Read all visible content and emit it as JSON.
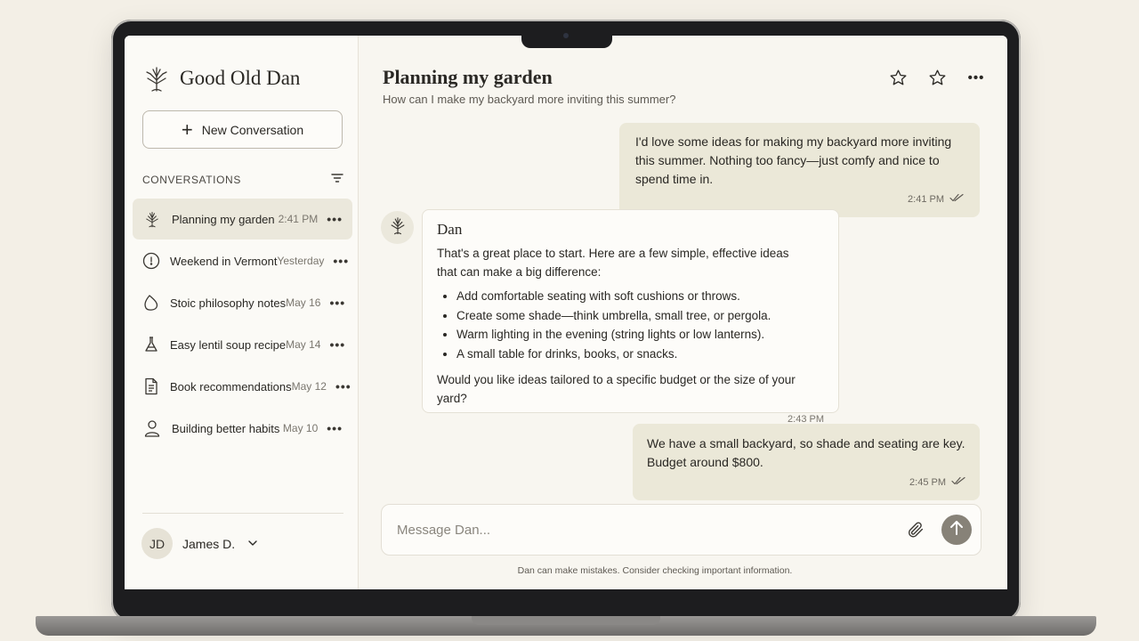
{
  "app": {
    "name": "Good Old Dan",
    "logo_icon": "tree-icon"
  },
  "sidebar": {
    "new_conversation_label": "New Conversation",
    "section_label": "CONVERSATIONS",
    "items": [
      {
        "title": "Planning my garden",
        "time": "2:41 PM",
        "icon": "tree-icon",
        "active": true
      },
      {
        "title": "Weekend in Vermont",
        "time": "Yesterday",
        "icon": "compass-icon",
        "active": false
      },
      {
        "title": "Stoic philosophy notes",
        "time": "May 16",
        "icon": "leaf-icon",
        "active": false
      },
      {
        "title": "Easy lentil soup recipe",
        "time": "May 14",
        "icon": "flask-icon",
        "active": false
      },
      {
        "title": "Book recommendations",
        "time": "May 12",
        "icon": "document-icon",
        "active": false
      },
      {
        "title": "Building better habits",
        "time": "May 10",
        "icon": "person-icon",
        "active": false
      }
    ],
    "more_glyph": "•••",
    "user": {
      "initials": "JD",
      "name": "James D."
    }
  },
  "chat": {
    "title": "Planning my garden",
    "subtitle": "How can I make my backyard more inviting this summer?",
    "messages": [
      {
        "role": "user",
        "text": "I'd love some ideas for making my backyard more inviting this summer. Nothing too fancy—just comfy and nice to spend time in.",
        "time": "2:41 PM"
      },
      {
        "role": "assistant",
        "sender": "Dan",
        "intro": "That's a great place to start. Here are a few simple, effective ideas that can make a big difference:",
        "bullets": [
          "Add comfortable seating with soft cushions or throws.",
          "Create some shade—think umbrella, small tree, or pergola.",
          "Warm lighting in the evening (string lights or low lanterns).",
          "A small table for drinks, books, or snacks."
        ],
        "followup": "Would you like ideas tailored to a specific budget or the size of your yard?",
        "time": "2:43 PM"
      },
      {
        "role": "user",
        "text": "We have a small backyard, so shade and seating are key. Budget around $800.",
        "time": "2:45 PM"
      }
    ],
    "composer_placeholder": "Message Dan...",
    "disclaimer": "Dan can make mistakes. Consider checking important information."
  },
  "colors": {
    "user_bubble": "#ebe8d8",
    "active_item": "#ebe8dc",
    "send_button": "#878278"
  }
}
